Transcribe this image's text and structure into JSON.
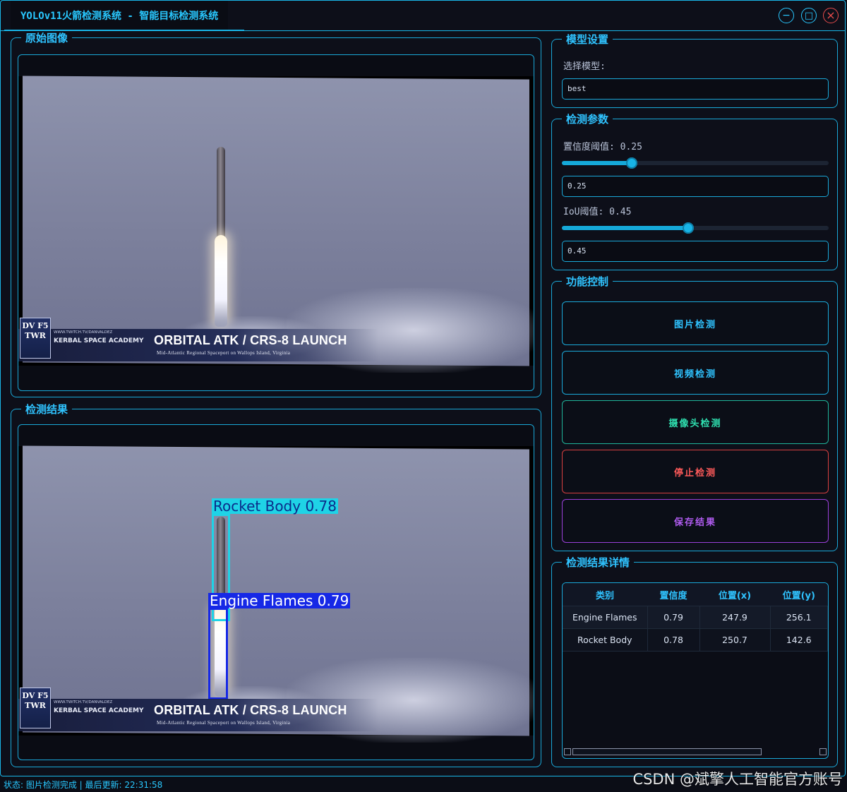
{
  "window": {
    "title": "YOLOv11火箭检测系统 - 智能目标检测系统",
    "minimize_symbol": "−",
    "maximize_symbol": "□",
    "close_symbol": "×"
  },
  "original": {
    "title": "原始图像",
    "banner_logo": "DV F5\nTWR",
    "banner_small": "WWW.TWITCH.TV/DANVALDEZ",
    "banner_academy": "KERBAL SPACE ACADEMY",
    "banner_main": "ORBITAL ATK / CRS-8 LAUNCH",
    "banner_sub": "Mid-Atlantic Regional Spaceport on Wallops Island, Virginia"
  },
  "result": {
    "title": "检测结果",
    "detections": [
      {
        "label": "Rocket Body 0.78",
        "color": "#1fd3e6",
        "text_color": "#0b2c8a"
      },
      {
        "label": "Engine Flames 0.79",
        "color": "#1628e6",
        "text_color": "#ffffff"
      }
    ]
  },
  "model": {
    "title": "模型设置",
    "select_label": "选择模型:",
    "selected": "best"
  },
  "params": {
    "title": "检测参数",
    "conf_label": "置信度阈值: 0.25",
    "conf_value": 0.25,
    "conf_input": "0.25",
    "iou_label": "IoU阈值: 0.45",
    "iou_value": 0.45,
    "iou_input": "0.45",
    "accent": "#15a9d9"
  },
  "controls": {
    "title": "功能控制",
    "image_detect": "图片检测",
    "video_detect": "视频检测",
    "camera_detect": "摄像头检测",
    "stop_detect": "停止检测",
    "save_result": "保存结果"
  },
  "details": {
    "title": "检测结果详情",
    "columns": [
      "类别",
      "置信度",
      "位置(x)",
      "位置(y)"
    ],
    "rows": [
      [
        "Engine Flames",
        "0.79",
        "247.9",
        "256.1"
      ],
      [
        "Rocket Body",
        "0.78",
        "250.7",
        "142.6"
      ]
    ]
  },
  "status": {
    "text": "状态: 图片检测完成 | 最后更新: 22:31:58"
  },
  "watermark": "CSDN @斌擎人工智能官方账号"
}
